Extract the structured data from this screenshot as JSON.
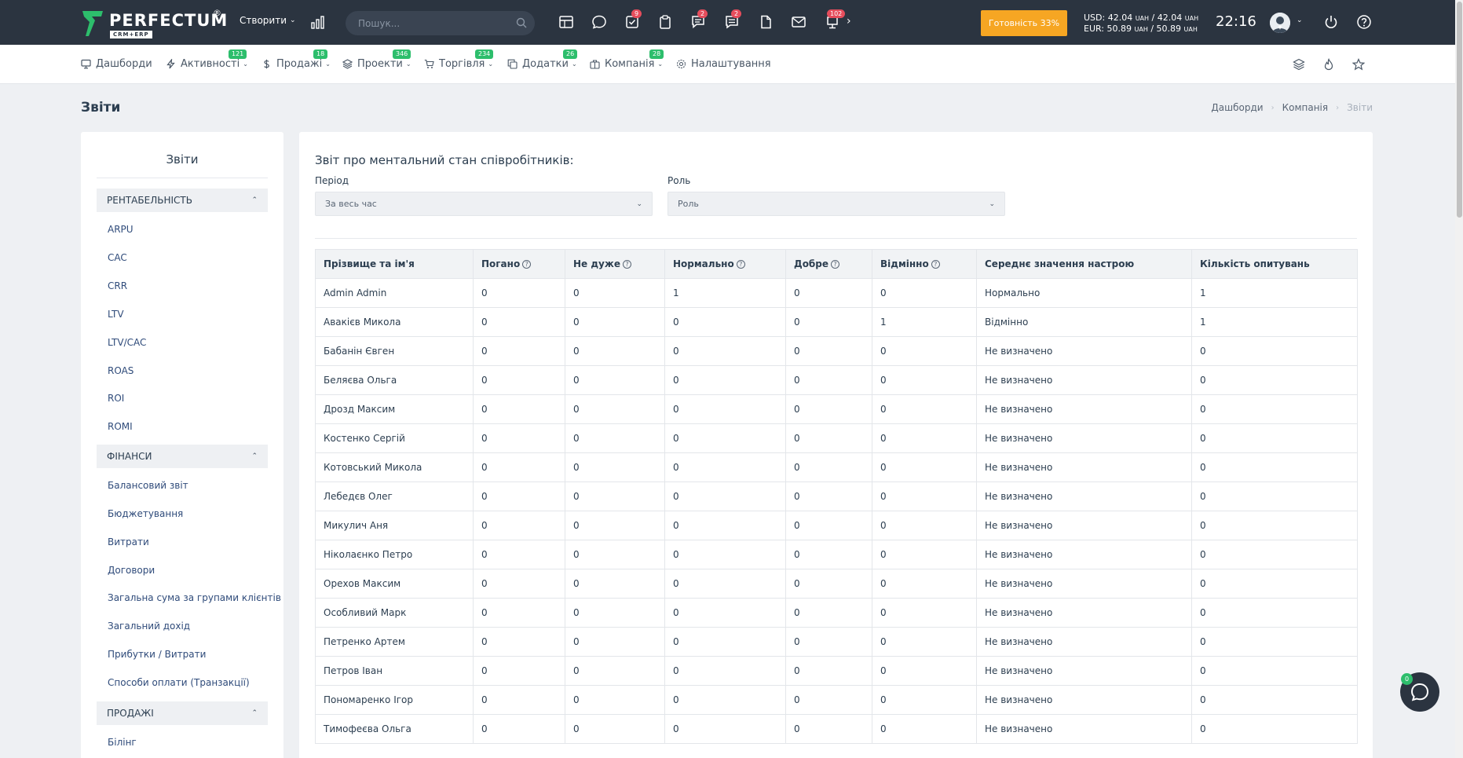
{
  "colors": {
    "header_bg": "#2b3440",
    "accent_orange": "#f6a623",
    "badge_red": "#e64d5c",
    "badge_green": "#2dbe6c",
    "link": "#2f4b7a",
    "logo_green": "#2dbe6c"
  },
  "header": {
    "logo_text": "PERFECTUM",
    "logo_reg": "®",
    "logo_sub": "CRM+ERP",
    "create_label": "Створити",
    "search_placeholder": "Пошук...",
    "icons": [
      {
        "name": "calendar-icon",
        "badge": ""
      },
      {
        "name": "chat-icon",
        "badge": ""
      },
      {
        "name": "tasks-icon",
        "badge": "9"
      },
      {
        "name": "clipboard-icon",
        "badge": ""
      },
      {
        "name": "comments-icon",
        "badge": "2"
      },
      {
        "name": "messages-icon",
        "badge": "2"
      },
      {
        "name": "document-icon",
        "badge": ""
      },
      {
        "name": "mail-icon",
        "badge": ""
      },
      {
        "name": "notifications-icon",
        "badge": "102"
      }
    ],
    "readiness_label": "Готовність 33%",
    "currency_usd": "USD: 42.04",
    "currency_usd_unit": "UAH",
    "currency_usd_sep": "/ 42.04",
    "currency_eur": "EUR: 50.89",
    "currency_eur_unit": "UAH",
    "currency_eur_sep": "/ 50.89",
    "time": "22:16"
  },
  "nav": {
    "items": [
      {
        "label": "Дашборди",
        "badge": "",
        "icon": "monitor-icon"
      },
      {
        "label": "Активності",
        "badge": "121",
        "icon": "bolt-icon"
      },
      {
        "label": "Продажі",
        "badge": "18",
        "icon": "dollar-icon"
      },
      {
        "label": "Проекти",
        "badge": "346",
        "icon": "layers-icon"
      },
      {
        "label": "Торгівля",
        "badge": "234",
        "icon": "cart-icon"
      },
      {
        "label": "Додатки",
        "badge": "26",
        "icon": "copy-icon"
      },
      {
        "label": "Компанія",
        "badge": "28",
        "icon": "briefcase-icon"
      },
      {
        "label": "Налаштування",
        "badge": "",
        "icon": "gear-icon"
      }
    ]
  },
  "page": {
    "title": "Звіти",
    "breadcrumb": [
      "Дашборди",
      "Компанія",
      "Звіти"
    ]
  },
  "sidebar": {
    "title": "Звіти",
    "sections": [
      {
        "label": "РЕНТАБЕЛЬНІСТЬ",
        "links": [
          "ARPU",
          "CAC",
          "CRR",
          "LTV",
          "LTV/CAC",
          "ROAS",
          "ROI",
          "ROMI"
        ]
      },
      {
        "label": "ФІНАНСИ",
        "links": [
          "Балансовий звіт",
          "Бюджетування",
          "Витрати",
          "Договори",
          "Загальна сума за групами клієнтів",
          "Загальний дохід",
          "Прибутки / Витрати",
          "Способи оплати (Транзакції)"
        ]
      },
      {
        "label": "ПРОДАЖІ",
        "links": [
          "Білінг"
        ]
      }
    ]
  },
  "report": {
    "title": "Звіт про ментальний стан співробітників:",
    "period_label": "Період",
    "period_value": "За весь час",
    "role_label": "Роль",
    "role_value": "Роль",
    "columns": [
      "Прізвище та ім'я",
      "Погано",
      "Не дуже",
      "Нормально",
      "Добре",
      "Відмінно",
      "Середнє значення настрою",
      "Кількість опитувань"
    ],
    "rows": [
      [
        "Admin Admin",
        "0",
        "0",
        "1",
        "0",
        "0",
        "Нормально",
        "1"
      ],
      [
        "Авакієв Микола",
        "0",
        "0",
        "0",
        "0",
        "1",
        "Відмінно",
        "1"
      ],
      [
        "Бабанін Євген",
        "0",
        "0",
        "0",
        "0",
        "0",
        "Не визначено",
        "0"
      ],
      [
        "Беляєва Ольга",
        "0",
        "0",
        "0",
        "0",
        "0",
        "Не визначено",
        "0"
      ],
      [
        "Дрозд Максим",
        "0",
        "0",
        "0",
        "0",
        "0",
        "Не визначено",
        "0"
      ],
      [
        "Костенко Сергій",
        "0",
        "0",
        "0",
        "0",
        "0",
        "Не визначено",
        "0"
      ],
      [
        "Котовський Микола",
        "0",
        "0",
        "0",
        "0",
        "0",
        "Не визначено",
        "0"
      ],
      [
        "Лебедєв Олег",
        "0",
        "0",
        "0",
        "0",
        "0",
        "Не визначено",
        "0"
      ],
      [
        "Микулич Аня",
        "0",
        "0",
        "0",
        "0",
        "0",
        "Не визначено",
        "0"
      ],
      [
        "Ніколаєнко Петро",
        "0",
        "0",
        "0",
        "0",
        "0",
        "Не визначено",
        "0"
      ],
      [
        "Орехов Максим",
        "0",
        "0",
        "0",
        "0",
        "0",
        "Не визначено",
        "0"
      ],
      [
        "Особливий Марк",
        "0",
        "0",
        "0",
        "0",
        "0",
        "Не визначено",
        "0"
      ],
      [
        "Петренко Артем",
        "0",
        "0",
        "0",
        "0",
        "0",
        "Не визначено",
        "0"
      ],
      [
        "Петров Іван",
        "0",
        "0",
        "0",
        "0",
        "0",
        "Не визначено",
        "0"
      ],
      [
        "Пономаренко Ігор",
        "0",
        "0",
        "0",
        "0",
        "0",
        "Не визначено",
        "0"
      ],
      [
        "Тимофеєва Ольга",
        "0",
        "0",
        "0",
        "0",
        "0",
        "Не визначено",
        "0"
      ]
    ]
  },
  "chat": {
    "badge": "0"
  }
}
